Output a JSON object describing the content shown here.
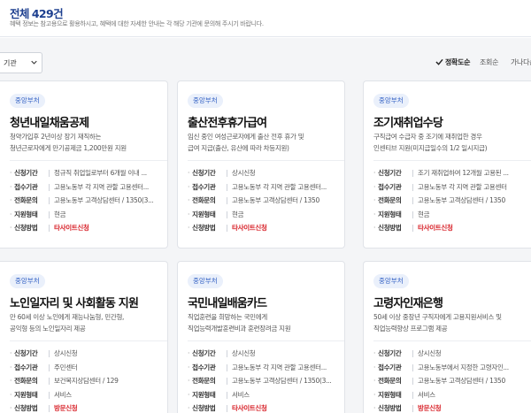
{
  "header": {
    "total_label": "전체",
    "total_count": "429건",
    "notice": "혜택 정보는 참고용으로 활용하시고, 혜택에 대한 자세한 안내는 각 해당 기관에 문의해 주시기 바랍니다."
  },
  "filter": {
    "selected": "기관"
  },
  "sort": [
    {
      "label": "정확도순",
      "active": true
    },
    {
      "label": "조회순",
      "active": false
    },
    {
      "label": "가나다순",
      "active": false
    }
  ],
  "field_labels": [
    "신청기간",
    "접수기관",
    "전화문의",
    "지원형태",
    "신청방법"
  ],
  "cards": [
    {
      "badge": "중앙부처",
      "title": "청년내일채움공제",
      "desc": [
        "청약가입후 2년이상 장기 재직하는",
        "청년근로자에게 만기공제금 1,200만원 지원"
      ],
      "fields": [
        "정규직 취업일로부터 6개월 이내 ...",
        "고용노동부 각 지역 관할 고용센터...",
        "고용노동부 고객상담센터 / 1350(3...",
        "현금",
        "타사이트신청"
      ]
    },
    {
      "badge": "중앙부처",
      "title": "출산전후휴가급여",
      "desc": [
        "임신 중인 여성근로자에게 출산 전후 휴가 및",
        "급여 지급(출산, 유산에 따라 차등지원)"
      ],
      "fields": [
        "상시신청",
        "고용노동부 각 지역 관할 고용센터...",
        "고용노동부 고객상담센터 / 1350",
        "현금",
        "타사이트신청"
      ]
    },
    {
      "badge": "중앙부처",
      "title": "조기재취업수당",
      "desc": [
        "구직급여 수급자 중 조기에 재취업한 경우",
        "인센티브 지원(미지급일수의 1/2 일시지급)"
      ],
      "fields": [
        "조기 재취업하여 12개월 고용된 ...",
        "고용노동부 각 지역 관할 고용센터",
        "고용노동부 고객상담센터 / 1350",
        "현금",
        "타사이트신청"
      ]
    },
    {
      "badge": "중앙부처",
      "title": "노인일자리 및 사회활동 지원",
      "desc": [
        "만 60세 이상 노인에게 재능나눔형, 민간형,",
        "공익형 등의 노인일자리 제공"
      ],
      "fields": [
        "상시신청",
        "주민센터",
        "보건복지상담센터 / 129",
        "서비스",
        "방문신청"
      ]
    },
    {
      "badge": "중앙부처",
      "title": "국민내일배움카드",
      "desc": [
        "직업훈련을 희망하는 국민에게",
        "직업능력개발훈련비과 훈련장려금 지원"
      ],
      "fields": [
        "상시신청",
        "고용노동부 각 지역 관할 고용센터...",
        "고용노동부 고객상담센터 / 1350(3...",
        "서비스",
        "타사이트신청"
      ]
    },
    {
      "badge": "중앙부처",
      "title": "고령자인재은행",
      "desc": [
        "50세 이상 중장년 구직자에게 고용지원서비스 및",
        "직업능력향상 프로그램 제공"
      ],
      "fields": [
        "상시신청",
        "고용노동부에서 지정한 고령자인...",
        "고용노동부 고객상담센터 / 1350",
        "서비스",
        "방문신청"
      ]
    }
  ]
}
